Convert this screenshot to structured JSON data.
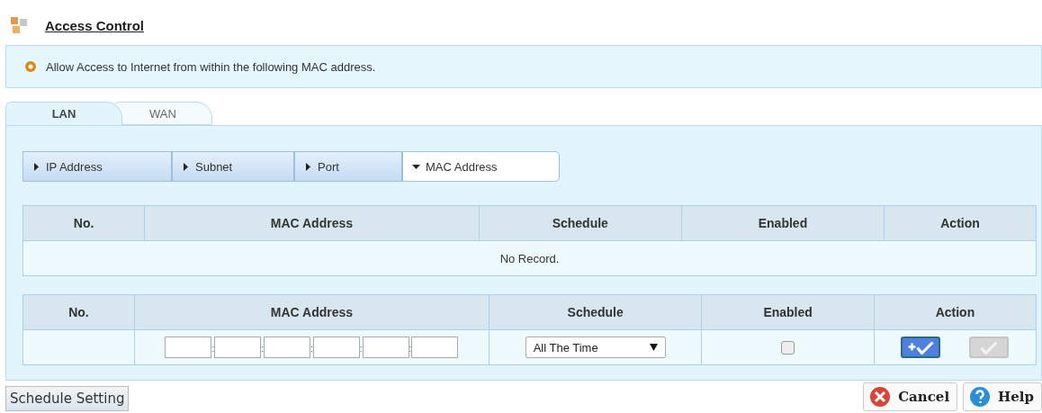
{
  "page": {
    "title": "Access Control"
  },
  "info": {
    "text": "Allow Access to Internet from within the following MAC address."
  },
  "tabs": [
    {
      "label": "LAN",
      "selected": true
    },
    {
      "label": "WAN",
      "selected": false
    }
  ],
  "filters": [
    {
      "label": "IP Address",
      "selected": false
    },
    {
      "label": "Subnet",
      "selected": false
    },
    {
      "label": "Port",
      "selected": false
    },
    {
      "label": "MAC Address",
      "selected": true
    }
  ],
  "records_table": {
    "columns": [
      "No.",
      "MAC Address",
      "Schedule",
      "Enabled",
      "Action"
    ],
    "empty_text": "No Record."
  },
  "entry_table": {
    "columns": [
      "No.",
      "MAC Address",
      "Schedule",
      "Enabled",
      "Action"
    ],
    "mac_separators": [
      ":",
      ":",
      ":",
      ":",
      ":"
    ],
    "schedule": {
      "value": "All The Time"
    },
    "enabled": {
      "checked": false
    },
    "actions": [
      {
        "kind": "add",
        "disabled": false
      },
      {
        "kind": "apply",
        "disabled": true
      }
    ]
  },
  "buttons": [
    {
      "kind": "schedule",
      "label": "Schedule Setting"
    },
    {
      "kind": "cancel",
      "label": "Cancel"
    },
    {
      "kind": "help",
      "label": "Help"
    }
  ]
}
